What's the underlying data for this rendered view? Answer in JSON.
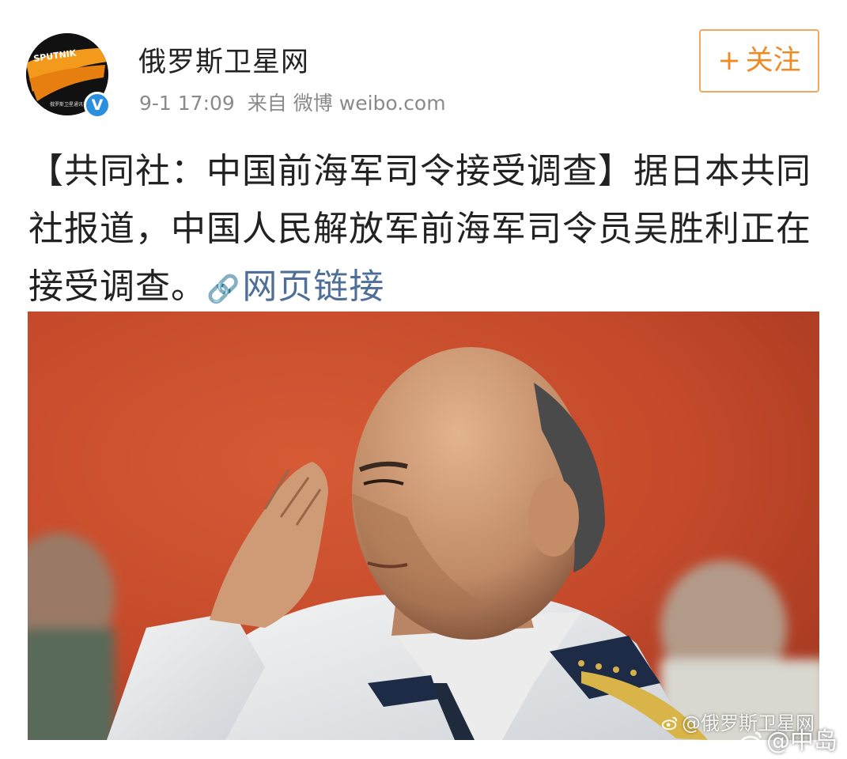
{
  "account": {
    "name": "俄罗斯卫星网",
    "avatar_logo_text": "SPUTNIK",
    "avatar_subtext": "俄罗斯卫星通讯社",
    "verified_icon": "verified-v-icon",
    "verified_glyph": "V"
  },
  "meta": {
    "time": "9-1 17:09",
    "source_prefix": "来自",
    "source": "微博 weibo.com"
  },
  "follow_button": {
    "plus": "+",
    "label": "关注"
  },
  "post": {
    "text": "【共同社：中国前海军司令接受调查】据日本共同社报道，中国人民解放军前海军司令员吴胜利正在接受调查。",
    "link_icon": "link-icon",
    "link_label": "网页链接"
  },
  "photo": {
    "watermark": "@俄罗斯卫星网"
  },
  "page_watermark": "@中岛",
  "colors": {
    "follow_accent": "#f08a24",
    "link": "#4f6f99",
    "verified": "#2b8fe0",
    "photo_background": "#c14a2c"
  }
}
